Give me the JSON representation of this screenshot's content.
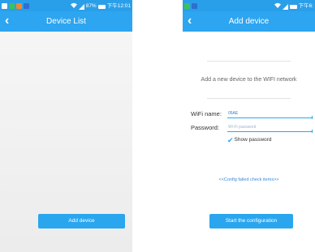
{
  "left_screen": {
    "status_bar": {
      "text": "87%",
      "time": "下午12:01"
    },
    "app_bar": {
      "back_glyph": "‹",
      "title": "Device List"
    },
    "add_button_label": "Add device"
  },
  "right_screen": {
    "status_bar": {
      "time": "下午6:"
    },
    "app_bar": {
      "back_glyph": "‹",
      "title": "Add device"
    },
    "intro_text": "Add a new device to the WIFI network",
    "wifi_name": {
      "label": "WiFi name:",
      "value": "05AE"
    },
    "password": {
      "label": "Password:",
      "placeholder": "Wi-Fi password"
    },
    "show_password": {
      "label": "Show password",
      "checked": true
    },
    "config_failed_link": "<<Config failed check items>>",
    "start_button_label": "Start the configuration"
  },
  "colors": {
    "status_bar": "#2a9fe9",
    "app_bar": "#2da5f0",
    "accent": "#2aa6ef",
    "link": "#3b86d8"
  },
  "icons": [
    "back-arrow-icon",
    "wifi-icon",
    "signal-icon",
    "battery-icon",
    "checkmark-icon"
  ]
}
